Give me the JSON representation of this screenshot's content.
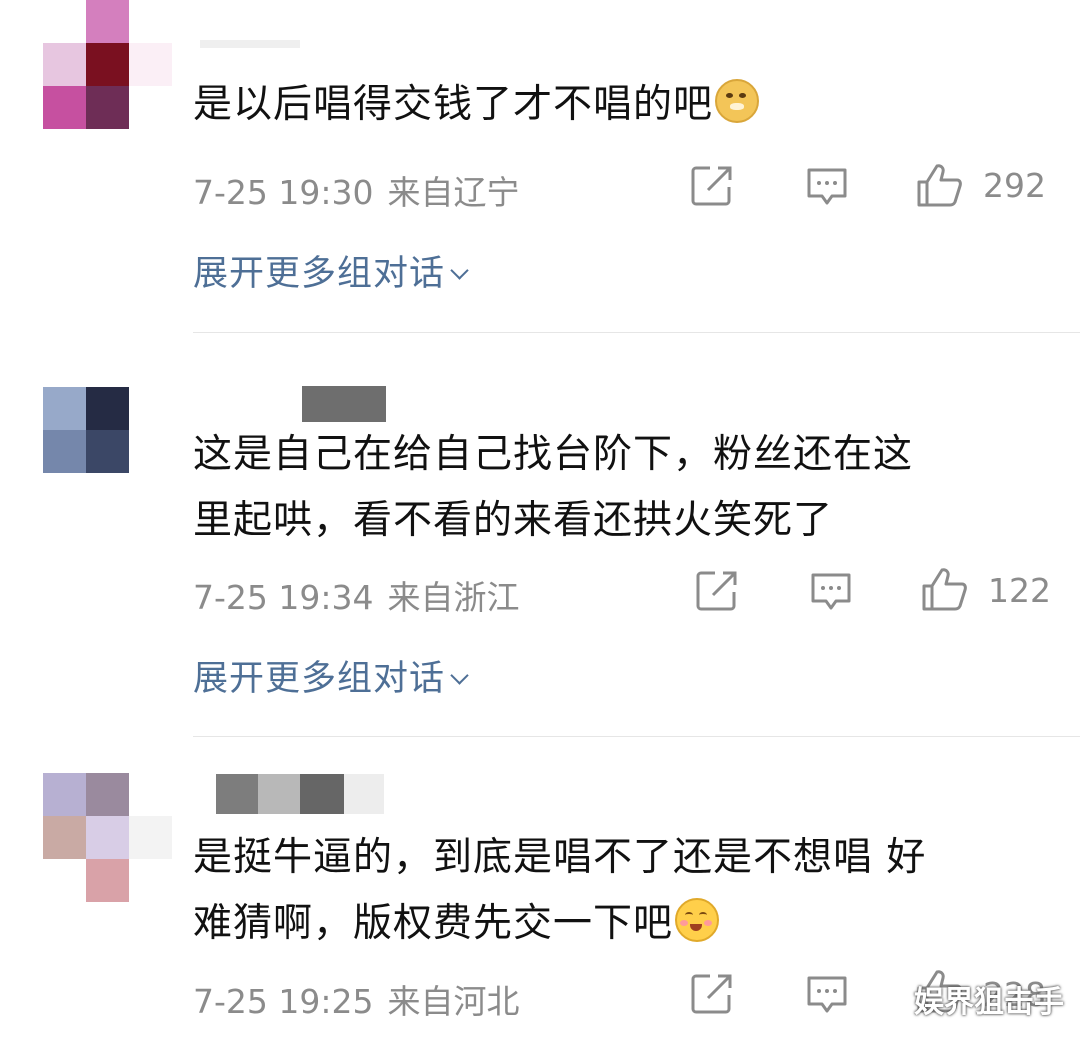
{
  "comments": [
    {
      "text": "是以后唱得交钱了才不唱的吧",
      "emoji": "doge-emoji",
      "date": "7-25 19:30",
      "location": "来自辽宁",
      "likes": "292",
      "expand_label": "展开更多组对话",
      "avatar_colors": [
        "#dba7cf",
        "#7a1020",
        "#f9eef5",
        "#c650a0",
        "#6e2d56",
        "#ffffff"
      ]
    },
    {
      "text": "这是自己在给自己找台阶下，粉丝还在这\n里起哄，看不看的来看还拱火笑死了",
      "date": "7-25 19:34",
      "location": "来自浙江",
      "likes": "122",
      "expand_label": "展开更多组对话",
      "avatar_colors": [
        "#97a9c9",
        "#252b44",
        "#ffffff",
        "#7587ab",
        "#3b4766",
        "#ffffff"
      ]
    },
    {
      "text": "是挺牛逼的，到底是唱不了还是不想唱 好\n难猜啊，版权费先交一下吧",
      "emoji": "blush-hug-emoji",
      "date": "7-25 19:25",
      "location": "来自河北",
      "likes": "228",
      "avatar_colors": [
        "#b7b0d2",
        "#9a8a9e",
        "#ffffff",
        "#c9aaa4",
        "#d8cde6",
        "#f3f3f3"
      ]
    }
  ],
  "watermark": "娱界狙击手",
  "colors": {
    "link": "#4e6f96",
    "meta": "#8b8b8b",
    "text": "#111111"
  }
}
